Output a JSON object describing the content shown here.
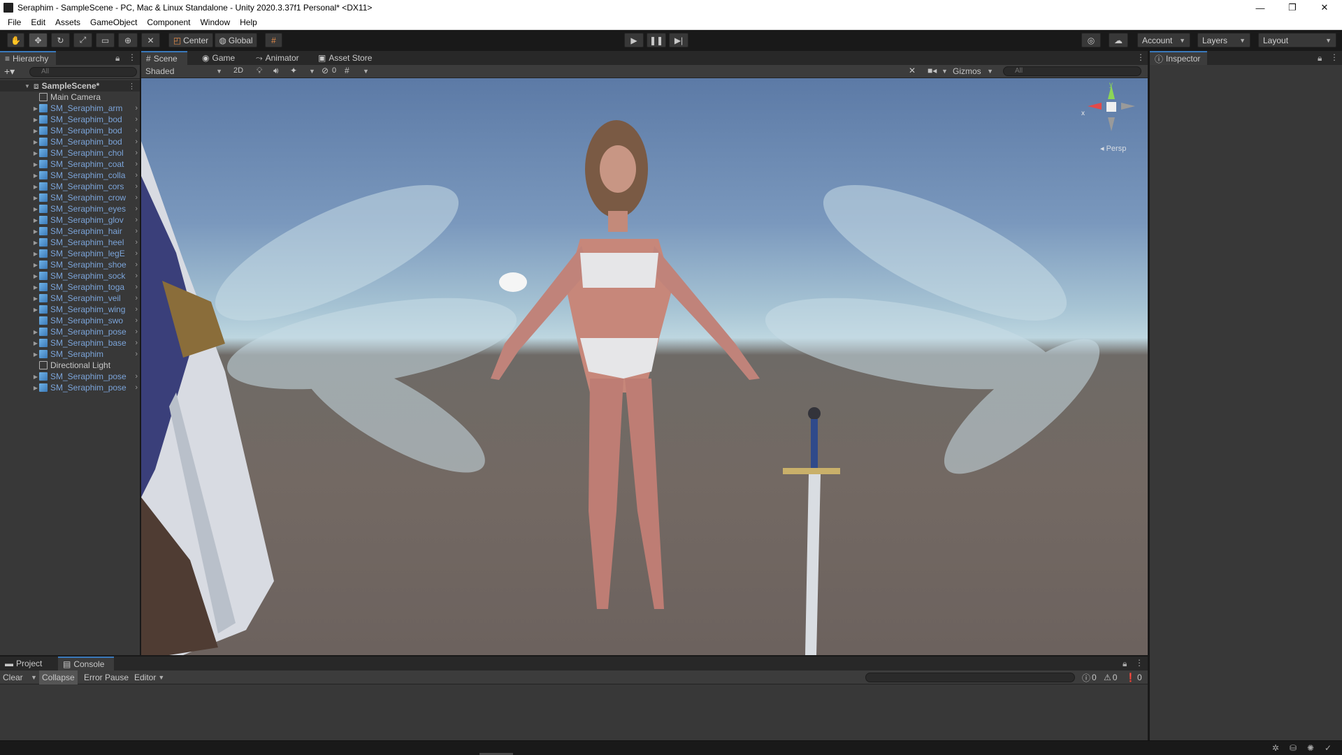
{
  "window": {
    "title": "Seraphim - SampleScene - PC, Mac & Linux Standalone - Unity 2020.3.37f1 Personal* <DX11>",
    "minimize": "—",
    "maximize": "❐",
    "close": "✕"
  },
  "menu": [
    "File",
    "Edit",
    "Assets",
    "GameObject",
    "Component",
    "Window",
    "Help"
  ],
  "toolbar": {
    "pivot": "Center",
    "space": "Global",
    "account": "Account",
    "layers": "Layers",
    "layout": "Layout"
  },
  "hierarchy": {
    "tab": "Hierarchy",
    "search_placeholder": "All",
    "scene": "SampleScene*",
    "items": [
      {
        "label": "Main Camera",
        "prefab": false,
        "expand": false
      },
      {
        "label": "SM_Seraphim_arm",
        "prefab": true,
        "expand": true
      },
      {
        "label": "SM_Seraphim_bod",
        "prefab": true,
        "expand": true
      },
      {
        "label": "SM_Seraphim_bod",
        "prefab": true,
        "expand": true
      },
      {
        "label": "SM_Seraphim_bod",
        "prefab": true,
        "expand": true
      },
      {
        "label": "SM_Seraphim_chol",
        "prefab": true,
        "expand": true
      },
      {
        "label": "SM_Seraphim_coat",
        "prefab": true,
        "expand": true
      },
      {
        "label": "SM_Seraphim_colla",
        "prefab": true,
        "expand": true
      },
      {
        "label": "SM_Seraphim_cors",
        "prefab": true,
        "expand": true
      },
      {
        "label": "SM_Seraphim_crow",
        "prefab": true,
        "expand": true
      },
      {
        "label": "SM_Seraphim_eyes",
        "prefab": true,
        "expand": true
      },
      {
        "label": "SM_Seraphim_glov",
        "prefab": true,
        "expand": true
      },
      {
        "label": "SM_Seraphim_hair",
        "prefab": true,
        "expand": true
      },
      {
        "label": "SM_Seraphim_heel",
        "prefab": true,
        "expand": true
      },
      {
        "label": "SM_Seraphim_legE",
        "prefab": true,
        "expand": true
      },
      {
        "label": "SM_Seraphim_shoe",
        "prefab": true,
        "expand": true
      },
      {
        "label": "SM_Seraphim_sock",
        "prefab": true,
        "expand": true
      },
      {
        "label": "SM_Seraphim_toga",
        "prefab": true,
        "expand": true
      },
      {
        "label": "SM_Seraphim_veil",
        "prefab": true,
        "expand": true
      },
      {
        "label": "SM_Seraphim_wing",
        "prefab": true,
        "expand": true
      },
      {
        "label": "SM_Seraphim_swo",
        "prefab": true,
        "expand": false
      },
      {
        "label": "SM_Seraphim_pose",
        "prefab": true,
        "expand": true
      },
      {
        "label": "SM_Seraphim_base",
        "prefab": true,
        "expand": true
      },
      {
        "label": "SM_Seraphim",
        "prefab": true,
        "expand": true
      },
      {
        "label": "Directional Light",
        "prefab": false,
        "expand": false
      },
      {
        "label": "SM_Seraphim_pose",
        "prefab": true,
        "expand": true
      },
      {
        "label": "SM_Seraphim_pose",
        "prefab": true,
        "expand": true
      }
    ]
  },
  "center_tabs": [
    "Scene",
    "Game",
    "Animator",
    "Asset Store"
  ],
  "scene_toolbar": {
    "draw_mode": "Shaded",
    "mode_2d": "2D",
    "hidden_count": "0",
    "gizmos": "Gizmos",
    "search_placeholder": "All"
  },
  "gizmo": {
    "y": "y",
    "x": "x",
    "persp": "Persp"
  },
  "inspector": {
    "tab": "Inspector"
  },
  "bottom_tabs": [
    "Project",
    "Console"
  ],
  "console": {
    "clear": "Clear",
    "collapse": "Collapse",
    "error_pause": "Error Pause",
    "editor": "Editor",
    "log_count": "0",
    "warn_count": "0",
    "error_count": "0"
  },
  "colors": {
    "accent": "#3a79bb",
    "prefab_text": "#7ba4d9"
  }
}
